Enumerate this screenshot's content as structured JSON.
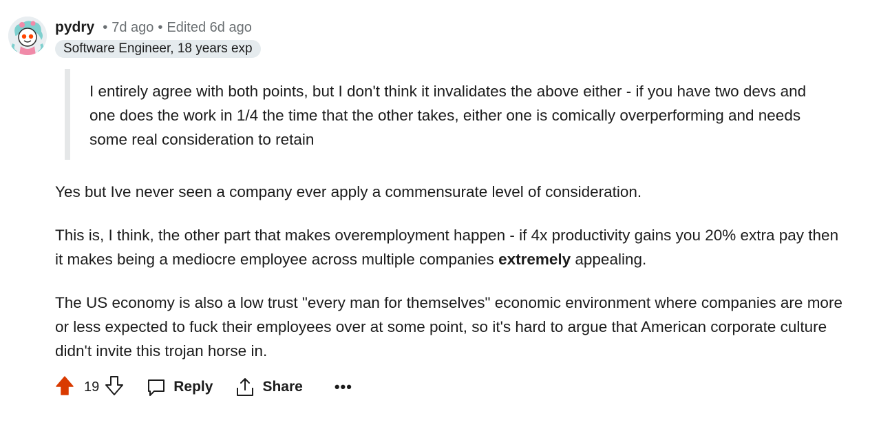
{
  "comment": {
    "author": "pydry",
    "dot1": "•",
    "posted": "7d ago",
    "dot2": "•",
    "edited": "Edited 6d ago",
    "flair": "Software Engineer, 18 years exp",
    "quote": "I entirely agree with both points, but I don't think it invalidates the above either - if you have two devs and one does the work in 1/4 the time that the other takes, either one is comically overperforming and needs some real consideration to retain",
    "paragraph1": "Yes but Ive never seen a company ever apply a commensurate level of consideration.",
    "paragraph2_before": "This is, I think, the other part that makes overemployment happen - if 4x productivity gains you 20% extra pay then it makes being a mediocre employee across multiple companies ",
    "paragraph2_bold": "extremely",
    "paragraph2_after": " appealing.",
    "paragraph3": "The US economy is also a low trust \"every man for themselves\" economic environment where companies are more or less expected to fuck their employees over at some point, so it's hard to argue that American corporate culture didn't invite this trojan horse in."
  },
  "actions": {
    "score": "19",
    "reply_label": "Reply",
    "share_label": "Share",
    "more_label": "•••"
  },
  "colors": {
    "upvote_active": "#d93a00",
    "meta_gray": "#6a6f72",
    "flair_bg": "#e5ebee"
  },
  "icons": [
    "upvote-icon",
    "downvote-icon",
    "comment-icon",
    "share-icon",
    "more-icon"
  ]
}
